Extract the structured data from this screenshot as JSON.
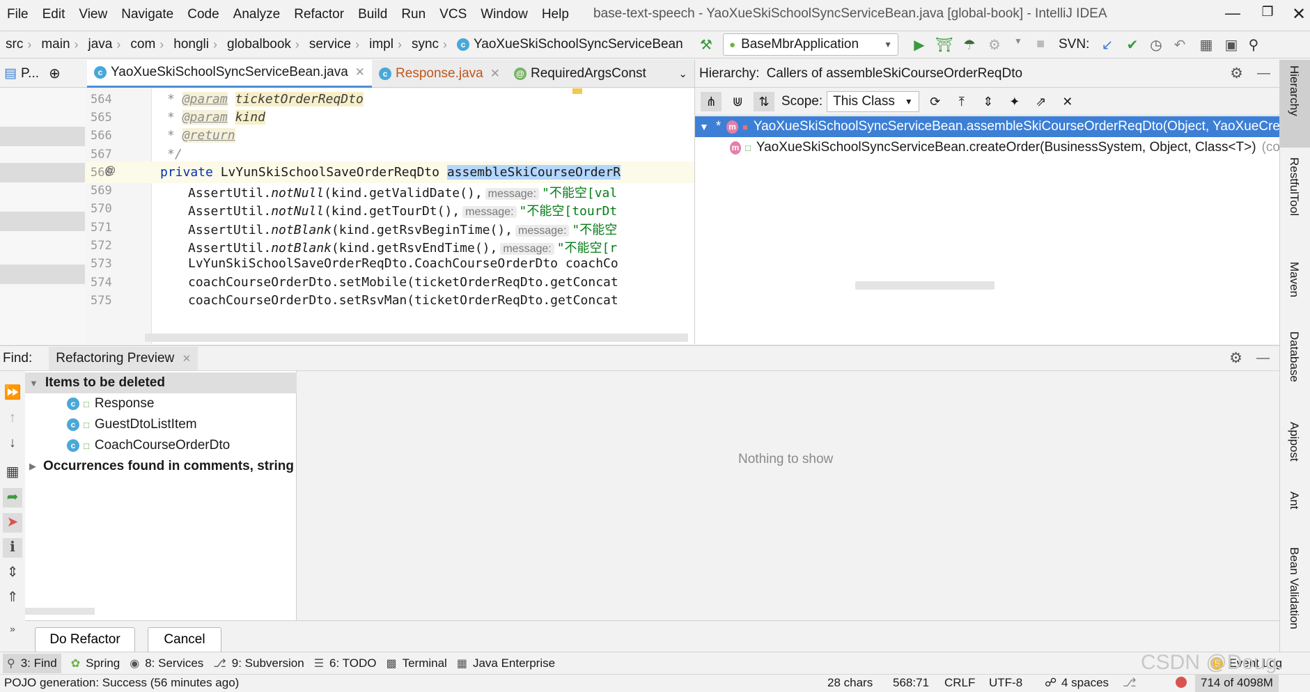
{
  "menu": [
    "File",
    "Edit",
    "View",
    "Navigate",
    "Code",
    "Analyze",
    "Refactor",
    "Build",
    "Run",
    "VCS",
    "Window",
    "Help"
  ],
  "window_title": "base-text-speech - YaoXueSkiSchoolSyncServiceBean.java [global-book] - IntelliJ IDEA",
  "breadcrumbs": [
    "src",
    "main",
    "java",
    "com",
    "hongli",
    "globalbook",
    "service",
    "impl",
    "sync",
    "YaoXueSkiSchoolSyncServiceBean"
  ],
  "run_config": "BaseMbrApplication",
  "svn_label": "SVN:",
  "project_tab": "P...",
  "editor_tabs": [
    {
      "label": "YaoXueSkiSchoolSyncServiceBean.java",
      "active": true
    },
    {
      "label": "Response.java",
      "active": false
    },
    {
      "label": "RequiredArgsConst",
      "active": false
    }
  ],
  "code_lines": [
    {
      "num": "564"
    },
    {
      "num": "565"
    },
    {
      "num": "566"
    },
    {
      "num": "567"
    },
    {
      "num": "568"
    },
    {
      "num": "569"
    },
    {
      "num": "570"
    },
    {
      "num": "571"
    },
    {
      "num": "572"
    },
    {
      "num": "573"
    },
    {
      "num": "574"
    },
    {
      "num": "575"
    }
  ],
  "code_text": {
    "l564_star": "* ",
    "l564_tag": "@param",
    "l564_param": "ticketOrderReqDto",
    "l565_star": "* ",
    "l565_tag": "@param",
    "l565_param": "kind",
    "l566_star": "* ",
    "l566_tag": "@return",
    "l567": "*/",
    "l568_kw": "private ",
    "l568_type": "LvYunSkiSchoolSaveOrderReqDto ",
    "l568_sel": "assembleSkiCourseOrderR",
    "l569_a": "AssertUtil.",
    "l569_fn": "notNull",
    "l569_b": "(kind.getValidDate(),",
    "l569_hint": "message:",
    "l569_str": "\"不能空[val",
    "l570_a": "AssertUtil.",
    "l570_fn": "notNull",
    "l570_b": "(kind.getTourDt(),",
    "l570_hint": "message:",
    "l570_str": "\"不能空[tourDt",
    "l571_a": "AssertUtil.",
    "l571_fn": "notBlank",
    "l571_b": "(kind.getRsvBeginTime(),",
    "l571_hint": "message:",
    "l571_str": "\"不能空",
    "l572_a": "AssertUtil.",
    "l572_fn": "notBlank",
    "l572_b": "(kind.getRsvEndTime(),",
    "l572_hint": "message:",
    "l572_str": "\"不能空[r",
    "l573": "LvYunSkiSchoolSaveOrderReqDto.CoachCourseOrderDto coachCo",
    "l574": "coachCourseOrderDto.setMobile(ticketOrderReqDto.getConcat",
    "l575": "coachCourseOrderDto.setRsvMan(ticketOrderReqDto.getConcat"
  },
  "hierarchy": {
    "title": "Hierarchy:",
    "subtitle": "Callers of assembleSkiCourseOrderReqDto",
    "scope_label": "Scope:",
    "scope_value": "This Class",
    "root": "YaoXueSkiSchoolSyncServiceBean.assembleSkiCourseOrderReqDto(Object, YaoXueCre",
    "child": "YaoXueSkiSchoolSyncServiceBean.createOrder(BusinessSystem, Object, Class<T>)",
    "child_suffix": "(co"
  },
  "find": {
    "label": "Find:",
    "tab": "Refactoring Preview",
    "group1": "Items to be deleted",
    "items": [
      "Response",
      "GuestDtoListItem",
      "CoachCourseOrderDto"
    ],
    "group2": "Occurrences found in comments, string",
    "empty": "Nothing to show",
    "do_refactor": "Do Refactor",
    "cancel": "Cancel"
  },
  "right_tools": [
    "Hierarchy",
    "RestfulTool",
    "Maven",
    "Database",
    "Apipost",
    "Ant",
    "Bean Validation"
  ],
  "bottom_tools": [
    "3: Find",
    "Spring",
    "8: Services",
    "9: Subversion",
    "6: TODO",
    "Terminal",
    "Java Enterprise",
    "Event Log"
  ],
  "event_badge": "5",
  "status": {
    "message": "POJO generation: Success (56 minutes ago)",
    "chars": "28 chars",
    "pos": "568:71",
    "eol": "CRLF",
    "enc": "UTF-8",
    "indent": "4 spaces",
    "memory": "714 of 4098M"
  },
  "watermark": "CSDN @Doug.",
  "colors": {
    "accent": "#4a8fd8",
    "selection": "#3d7fd5",
    "run": "#3c9a3c"
  }
}
